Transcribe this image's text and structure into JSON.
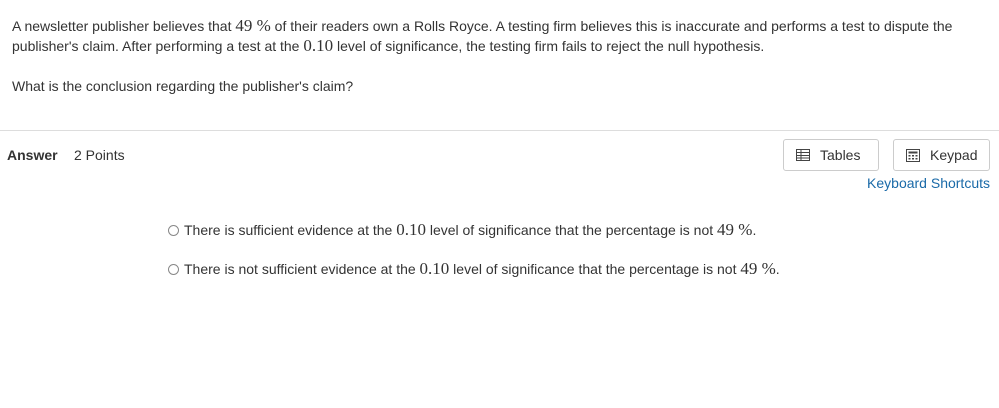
{
  "question": {
    "part1": "A newsletter publisher believes that ",
    "percent_value": "49 %",
    "part2": " of their readers own a Rolls Royce. A testing firm believes this is inaccurate and performs a test to dispute the publisher's claim. After performing a test at the ",
    "significance": "0.10",
    "part3": " level of significance, the testing firm fails to reject the null hypothesis.",
    "prompt": "What is the conclusion regarding the publisher's claim?"
  },
  "answer": {
    "label": "Answer",
    "points": "2 Points"
  },
  "tools": {
    "tables_label": "Tables",
    "tables_icon": "table-icon",
    "keypad_label": "Keypad",
    "keypad_icon": "calculator-icon",
    "shortcuts_label": "Keyboard Shortcuts"
  },
  "options": [
    {
      "pre": "There is sufficient evidence at the ",
      "level": "0.10",
      "mid": " level of significance that the percentage is not ",
      "percent": "49 %",
      "post": "."
    },
    {
      "pre": "There is not sufficient evidence at the ",
      "level": "0.10",
      "mid": " level of significance that the percentage is not ",
      "percent": "49 %",
      "post": "."
    }
  ],
  "colors": {
    "link": "#1a6aa8",
    "text": "#333333",
    "border": "#cccccc"
  }
}
